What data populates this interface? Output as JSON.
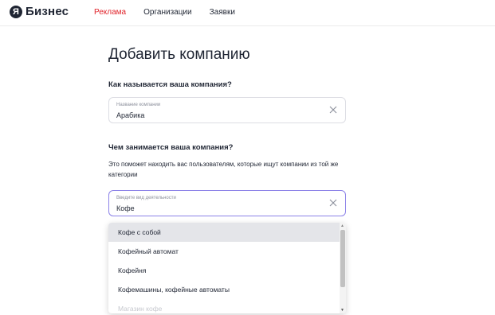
{
  "header": {
    "logo_glyph": "Я",
    "logo_text": "Бизнес",
    "nav": [
      {
        "label": "Реклама",
        "active": true
      },
      {
        "label": "Организации",
        "active": false
      },
      {
        "label": "Заявки",
        "active": false
      }
    ],
    "accent_color": "#e0232a"
  },
  "main": {
    "title": "Добавить компанию",
    "name_section": {
      "question": "Как называется ваша компания?",
      "field_label": "Название компании",
      "field_value": "Арабика"
    },
    "activity_section": {
      "question": "Чем занимается ваша компания?",
      "hint": "Это поможет находить вас пользователям, которые ищут компании из той же категории",
      "field_label": "Введите вид деятельности",
      "field_value": "Кофе"
    },
    "suggestions": [
      "Кофе с собой",
      "Кофейный автомат",
      "Кофейня",
      "Кофемашины, кофейные автоматы",
      "Магазин кофе"
    ],
    "focus_color": "#8c82e8"
  }
}
